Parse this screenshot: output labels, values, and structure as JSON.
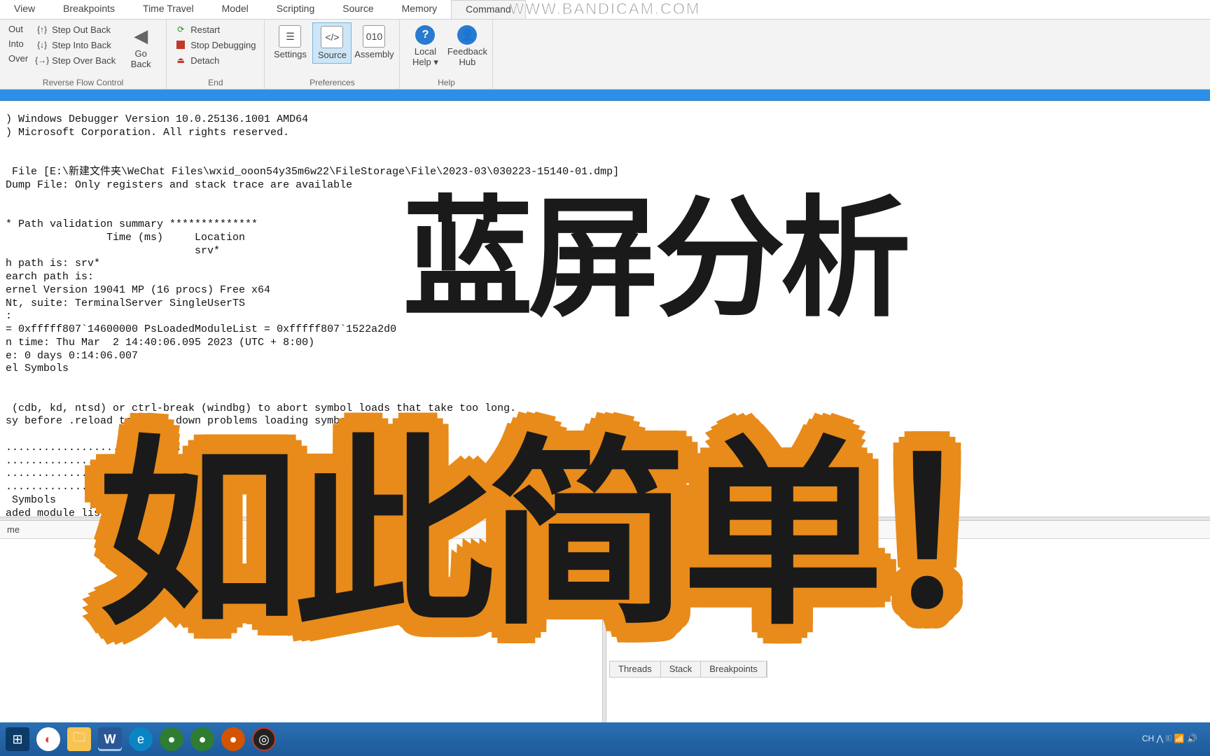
{
  "watermark": "WWW.BANDICAM.COM",
  "ribbon_tabs": [
    "View",
    "Breakpoints",
    "Time Travel",
    "Model",
    "Scripting",
    "Source",
    "Memory",
    "Command"
  ],
  "active_tab_index": 7,
  "groups": {
    "reverse": {
      "label": "Reverse Flow Control",
      "col1": [
        "Out",
        "Into",
        "Over"
      ],
      "col2": [
        "Step Out Back",
        "Step Into Back",
        "Step Over Back"
      ],
      "go_back": "Go\nBack"
    },
    "end": {
      "label": "End",
      "items": [
        "Restart",
        "Stop Debugging",
        "Detach"
      ]
    },
    "prefs": {
      "label": "Preferences",
      "items": [
        "Settings",
        "Source",
        "Assembly"
      ]
    },
    "help": {
      "label": "Help",
      "local": "Local\nHelp ▾",
      "feedback": "Feedback\nHub"
    }
  },
  "console_text": ") Windows Debugger Version 10.0.25136.1001 AMD64\n) Microsoft Corporation. All rights reserved.\n\n\n File [E:\\新建文件夹\\WeChat Files\\wxid_ooon54y35m6w22\\FileStorage\\File\\2023-03\\030223-15140-01.dmp]\nDump File: Only registers and stack trace are available\n\n\n* Path validation summary **************\n                Time (ms)     Location\n                              srv*\nh path is: srv*\nearch path is:\nernel Version 19041 MP (16 procs) Free x64\nNt, suite: TerminalServer SingleUserTS\n:\n= 0xfffff807`14600000 PsLoadedModuleList = 0xfffff807`1522a2d0\nn time: Thu Mar  2 14:40:06.095 2023 (UTC + 8:00)\ne: 0 days 0:14:06.007\nel Symbols\n\n\n (cdb, kd, ntsd) or ctrl-break (windbg) to abort symbol loads that take too long.\nsy before .reload to track down problems loading symbols.\n\n................................................\n................................................\n................................................\n........................................\n Symbols\naded module list\n......\n of this file  run",
  "panel_col": "me",
  "bottom_tabs": [
    "Threads",
    "Stack",
    "Breakpoints"
  ],
  "overlay1": "蓝屏分析",
  "overlay2": "如此简单！",
  "systray": "CH  ⋀  🗉 📶 🔊"
}
